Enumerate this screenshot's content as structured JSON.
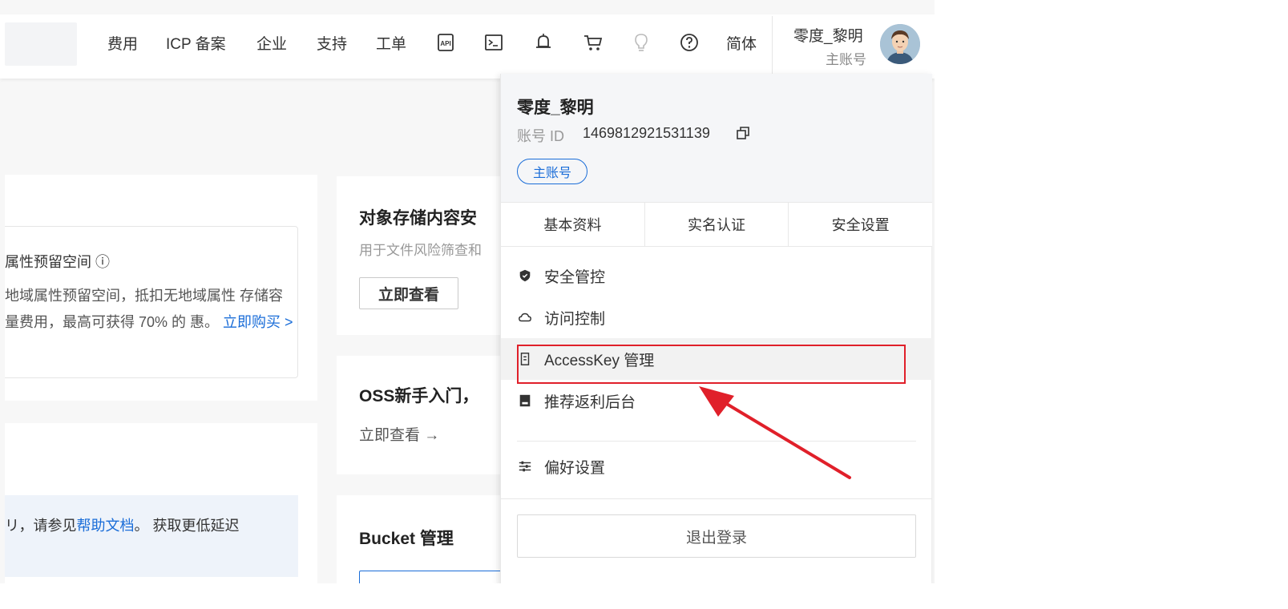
{
  "header": {
    "nav": [
      "费用",
      "ICP 备案",
      "企业",
      "支持",
      "工单"
    ],
    "icons": [
      "api-icon",
      "terminal-icon",
      "bell-icon",
      "cart-icon",
      "lightbulb-icon",
      "help-icon"
    ],
    "language": "简体",
    "user_name": "零度_黎明",
    "user_role": "主账号"
  },
  "background": {
    "card1": {
      "title": "属性预留空间 ⓘ",
      "text_before_link": "地域属性预留空间，抵扣无地域属性 存储容量费用，最高可获得 70% 的 惠。",
      "link": "立即购买 >"
    },
    "card2": {
      "text_before": "リ，请参见",
      "link": "帮助文档",
      "text_after": "。 获取更低延迟"
    },
    "right1": {
      "title": "对象存储内容安",
      "subtitle": "用于文件风险筛查和",
      "button": "立即查看"
    },
    "right2": {
      "title": "OSS新手入门，",
      "link": "立即查看 →"
    },
    "right3": {
      "title": "Bucket 管理"
    }
  },
  "dropdown": {
    "name": "零度_黎明",
    "id_label": "账号 ID",
    "id_value": "1469812921531139",
    "badge": "主账号",
    "tabs": [
      "基本资料",
      "实名认证",
      "安全设置"
    ],
    "items": [
      {
        "label": "安全管控",
        "icon": "shield-icon"
      },
      {
        "label": "访问控制",
        "icon": "cloud-icon"
      },
      {
        "label": "AccessKey 管理",
        "icon": "key-icon"
      },
      {
        "label": "推荐返利后台",
        "icon": "dashboard-icon"
      },
      {
        "label": "偏好设置",
        "icon": "sliders-icon"
      }
    ],
    "logout": "退出登录"
  },
  "annotation": {
    "highlight_color": "#e0202a"
  }
}
